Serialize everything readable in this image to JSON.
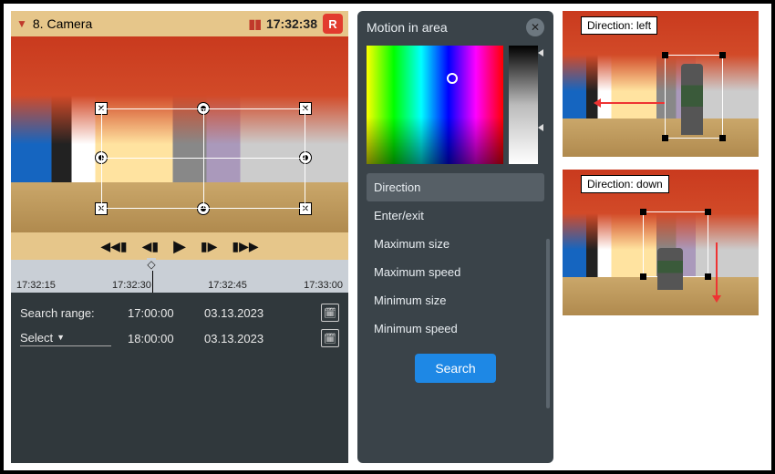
{
  "camera": {
    "title": "8. Camera",
    "clock": "17:32:38",
    "rec_badge": "R"
  },
  "timeline": {
    "ticks": [
      "17:32:15",
      "17:32:30",
      "17:32:45",
      "17:33:00"
    ]
  },
  "search_range": {
    "label": "Search range:",
    "from_time": "17:00:00",
    "from_date": "03.13.2023",
    "to_time": "18:00:00",
    "to_date": "03.13.2023",
    "select_label": "Select"
  },
  "motion_panel": {
    "title": "Motion in area",
    "options": [
      "Direction",
      "Enter/exit",
      "Maximum size",
      "Maximum speed",
      "Minimum size",
      "Minimum speed"
    ],
    "selected_index": 0,
    "search_button": "Search"
  },
  "previews": {
    "left_label": "Direction: left",
    "down_label": "Direction: down"
  },
  "colors": {
    "header_bg": "#e6c68a",
    "accent_red": "#e23b2e",
    "panel_bg": "#3a4349",
    "search_bg": "#30383c",
    "primary_btn": "#1e88e5"
  }
}
